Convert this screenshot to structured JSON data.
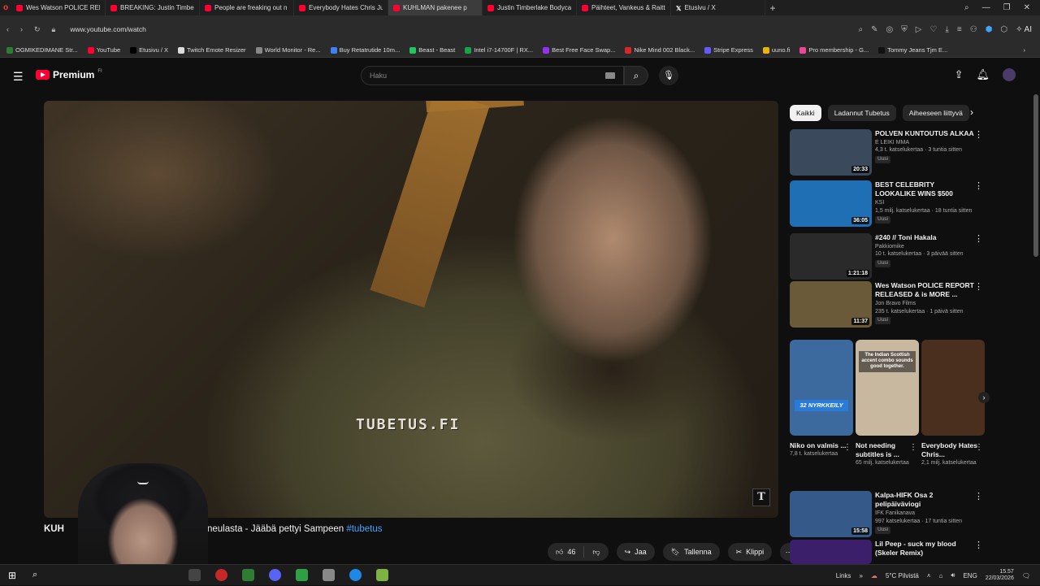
{
  "browser": {
    "tabs": [
      {
        "label": "Wes Watson POLICE REPO",
        "icon": "youtube-icon"
      },
      {
        "label": "BREAKING: Justin Timberl",
        "icon": "youtube-icon"
      },
      {
        "label": "People are freaking out n",
        "icon": "youtube-icon"
      },
      {
        "label": "Everybody Hates Chris Ju",
        "icon": "youtube-icon"
      },
      {
        "label": "KUHLMAN pakenee p",
        "icon": "youtube-icon",
        "active": true
      },
      {
        "label": "Justin Timberlake Bodyca",
        "icon": "youtube-icon"
      },
      {
        "label": "Päihteet, Vankeus & Raitti",
        "icon": "youtube-icon"
      },
      {
        "label": "Etusivu / X",
        "icon": "x-icon"
      }
    ],
    "new_tab": "+",
    "url": "www.youtube.com/watch",
    "ai_button": "AI",
    "bookmarks": [
      {
        "label": "OGMIKEDIMANE Str...",
        "color": "#2e7d32"
      },
      {
        "label": "YouTube",
        "color": "#ff0033"
      },
      {
        "label": "Etusivu / X",
        "color": "#000000"
      },
      {
        "label": "Twitch Emote Resizer",
        "color": "#dddddd"
      },
      {
        "label": "World Monitor - Re...",
        "color": "#888888"
      },
      {
        "label": "Buy Retatrutide 10m...",
        "color": "#3b82f6"
      },
      {
        "label": "Beast - Beast",
        "color": "#22c55e"
      },
      {
        "label": "Intel i7-14700F | RX...",
        "color": "#16a34a"
      },
      {
        "label": "Best Free Face Swap...",
        "color": "#9333ea"
      },
      {
        "label": "Nike Mind 002 Black...",
        "color": "#dc2626"
      },
      {
        "label": "Stripe Express",
        "color": "#635bff"
      },
      {
        "label": "uuno.fi",
        "color": "#eab308"
      },
      {
        "label": "Pro membership - G...",
        "color": "#ec4899"
      },
      {
        "label": "Tommy Jeans Tjm E...",
        "color": "#111111"
      }
    ]
  },
  "youtube": {
    "logo_text": "Premium",
    "logo_sup": "FI",
    "search_placeholder": "Haku",
    "video": {
      "watermark": "TUBETUS.FI",
      "title_head": "KUH",
      "title_rest": "neulasta - Jääbä pettyi Sampeen ",
      "hashtag": "#tubetus",
      "likes": "46",
      "share": "Jaa",
      "save": "Tallenna",
      "clip": "Klippi"
    },
    "chips": [
      "Kaikki",
      "Ladannut Tubetus",
      "Aiheeseen liittyvä"
    ],
    "recommended": [
      {
        "title": "POLVEN KUNTOUTUS ALKAA",
        "channel": "E LEIKI MMA",
        "stats": "4,3 t. katselukertaa · 3 tuntia sitten",
        "badge": "Uusi",
        "duration": "20:33",
        "thumb": "#3a4a5c"
      },
      {
        "title": "BEST CELEBRITY LOOKALIKE WINS $500",
        "channel": "KSI",
        "stats": "1,5 milj. katselukertaa · 18 tuntia sitten",
        "badge": "Uusi",
        "duration": "36:05",
        "thumb": "#1f6fb5"
      },
      {
        "title": "#240 // Toni Hakala",
        "channel": "Pakkiomike",
        "stats": "10 t. katselukertaa · 3 päivää sitten",
        "badge": "Uusi",
        "duration": "1:21:18",
        "thumb": "#2a2a2a"
      },
      {
        "title": "Wes Watson POLICE REPORT RELEASED & is MORE ...",
        "channel": "Jon Bravo Films",
        "stats": "235 t. katselukertaa · 1 päivä sitten",
        "badge": "Uusi",
        "duration": "11:37",
        "thumb": "#6b5a3a"
      },
      {
        "title": "Kalpa-HIFK Osa 2 pelipäiväviogi",
        "channel": "IFK Fanikanava",
        "stats": "997 katselukertaa · 17 tuntia sitten",
        "badge": "Uusi",
        "duration": "15:58",
        "thumb": "#355a8a"
      },
      {
        "title": "Lil Peep - suck my blood (Skeler Remix)",
        "channel": "",
        "stats": "",
        "badge": "",
        "duration": "",
        "thumb": "#3b1f6b"
      }
    ],
    "shorts": [
      {
        "title": "Niko on valmis ...",
        "views": "7,8 t. katselukertaa",
        "overlay": "32 NYRKKEILY",
        "thumb": "#3d6a9e"
      },
      {
        "title": "Not needing subtitles is ...",
        "views": "65 milj. katselukertaa",
        "overlay": "The Indian Scottish accent combo sounds good together.",
        "thumb": "#c9b8a0"
      },
      {
        "title": "Everybody Hates Chris...",
        "views": "2,1 milj. katselukertaa",
        "overlay": "",
        "thumb": "#4a2e1e"
      }
    ]
  },
  "taskbar": {
    "links_label": "Links",
    "weather": "5°C  Pilvistä",
    "language": "ENG",
    "time": "15.57",
    "date": "22/03/2026"
  }
}
